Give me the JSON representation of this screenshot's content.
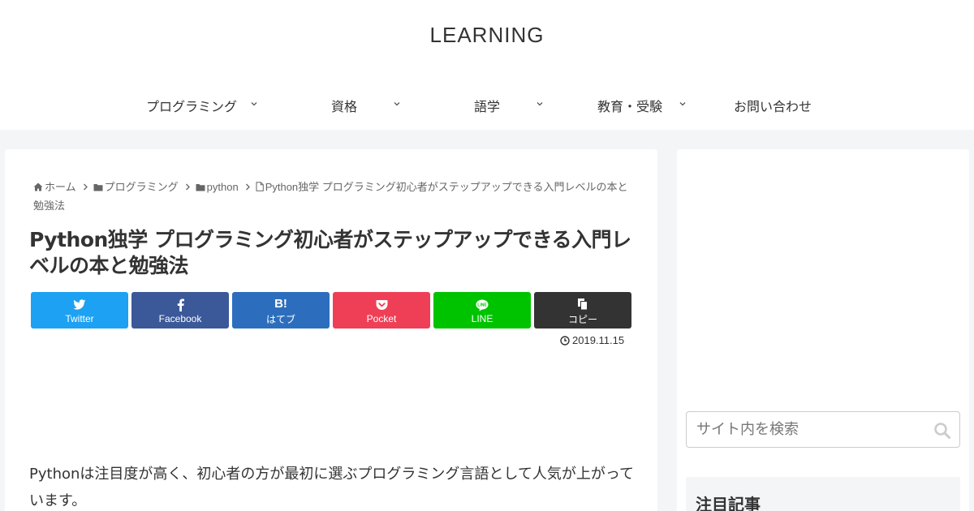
{
  "site": {
    "title": "LEARNING"
  },
  "nav": [
    {
      "label": "プログラミング",
      "has_submenu": true
    },
    {
      "label": "資格",
      "has_submenu": true
    },
    {
      "label": "語学",
      "has_submenu": true
    },
    {
      "label": "教育・受験",
      "has_submenu": true
    },
    {
      "label": "お問い合わせ",
      "has_submenu": false
    }
  ],
  "breadcrumb": [
    {
      "label": "ホーム",
      "icon": "home-icon"
    },
    {
      "label": "プログラミング",
      "icon": "folder-icon"
    },
    {
      "label": "python",
      "icon": "folder-icon"
    },
    {
      "label": "Python独学 プログラミング初心者がステップアップできる入門レベルの本と勉強法",
      "icon": "file-icon"
    }
  ],
  "post": {
    "title": "Python独学 プログラミング初心者がステップアップできる入門レベルの本と勉強法",
    "date": "2019.11.15",
    "body_first": "Pythonは注目度が高く、初心者の方が最初に選ぶプログラミング言語として人気が上がっています。"
  },
  "share": [
    {
      "label": "Twitter",
      "icon": "twitter-icon",
      "color": "#1da1f2"
    },
    {
      "label": "Facebook",
      "icon": "facebook-icon",
      "color": "#3b5998"
    },
    {
      "label": "はてブ",
      "icon": "hatena-icon",
      "color": "#2c6ebd"
    },
    {
      "label": "Pocket",
      "icon": "pocket-icon",
      "color": "#ef3f56"
    },
    {
      "label": "LINE",
      "icon": "line-icon",
      "color": "#00c300"
    },
    {
      "label": "コピー",
      "icon": "copy-icon",
      "color": "#333333"
    }
  ],
  "sidebar": {
    "search_placeholder": "サイト内を検索",
    "widget_title": "注目記事"
  }
}
